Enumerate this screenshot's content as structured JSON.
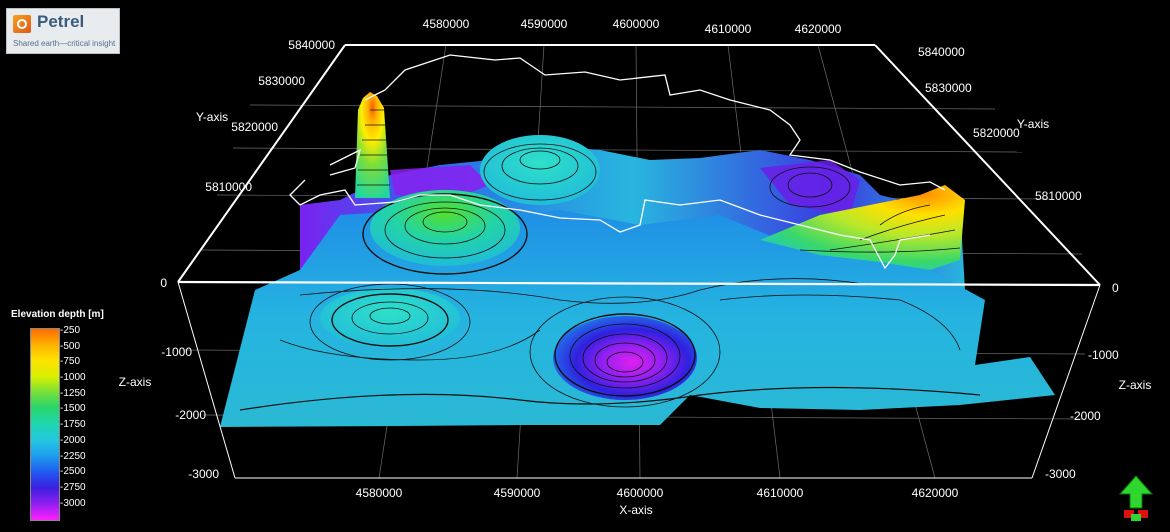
{
  "app": {
    "logo_name": "Petrel",
    "logo_tagline": "Shared earth—critical insight"
  },
  "legend": {
    "title": "Elevation depth [m]",
    "ticks": [
      "-250",
      "-500",
      "-750",
      "-1000",
      "-1250",
      "-1500",
      "-1750",
      "-2000",
      "-2250",
      "-2500",
      "-2750",
      "-3000"
    ]
  },
  "axes": {
    "x_title": "X-axis",
    "y_title": "Y-axis",
    "z_title": "Z-axis",
    "x_top_ticks": [
      "4580000",
      "4590000",
      "4600000",
      "4610000",
      "4620000"
    ],
    "x_bottom_ticks": [
      "4580000",
      "4590000",
      "4600000",
      "4610000",
      "4620000"
    ],
    "y_left_ticks": [
      "5840000",
      "5830000",
      "5820000",
      "5810000"
    ],
    "y_right_ticks": [
      "5840000",
      "5830000",
      "5820000",
      "5810000"
    ],
    "z_left_ticks": [
      "0",
      "-1000",
      "-2000",
      "-3000"
    ],
    "z_right_ticks": [
      "0",
      "-1000",
      "-2000",
      "-3000"
    ]
  },
  "chart_data": {
    "type": "surface",
    "title": "",
    "xlabel": "X-axis",
    "ylabel": "Y-axis",
    "zlabel": "Z-axis",
    "xlim": [
      4570000,
      4630000
    ],
    "ylim": [
      5800000,
      5845000
    ],
    "zlim": [
      -3000,
      0
    ],
    "colorbar": {
      "label": "Elevation depth [m]",
      "range": [
        -3000,
        -250
      ]
    },
    "grid": true,
    "features": [
      {
        "name": "peak",
        "x": 4579500,
        "y": 5821000,
        "z": -300
      },
      {
        "name": "peak",
        "x": 4621000,
        "y": 5810000,
        "z": -500
      },
      {
        "name": "dome",
        "x": 4585000,
        "y": 5810000,
        "z": -1200
      },
      {
        "name": "dome",
        "x": 4595000,
        "y": 5823000,
        "z": -1600
      },
      {
        "name": "dome",
        "x": 4583000,
        "y": 5800000,
        "z": -1700
      },
      {
        "name": "basin",
        "x": 4598000,
        "y": 5798000,
        "z": -2900
      },
      {
        "name": "basin",
        "x": 4582000,
        "y": 5828000,
        "z": -2800
      },
      {
        "name": "basin",
        "x": 4613000,
        "y": 5830000,
        "z": -2700
      }
    ]
  },
  "colors": {
    "background": "#000000",
    "axis_box": "#ffffff",
    "grid": "#6e6e6e",
    "contour": "#101010",
    "boundary": "#ffffff"
  }
}
